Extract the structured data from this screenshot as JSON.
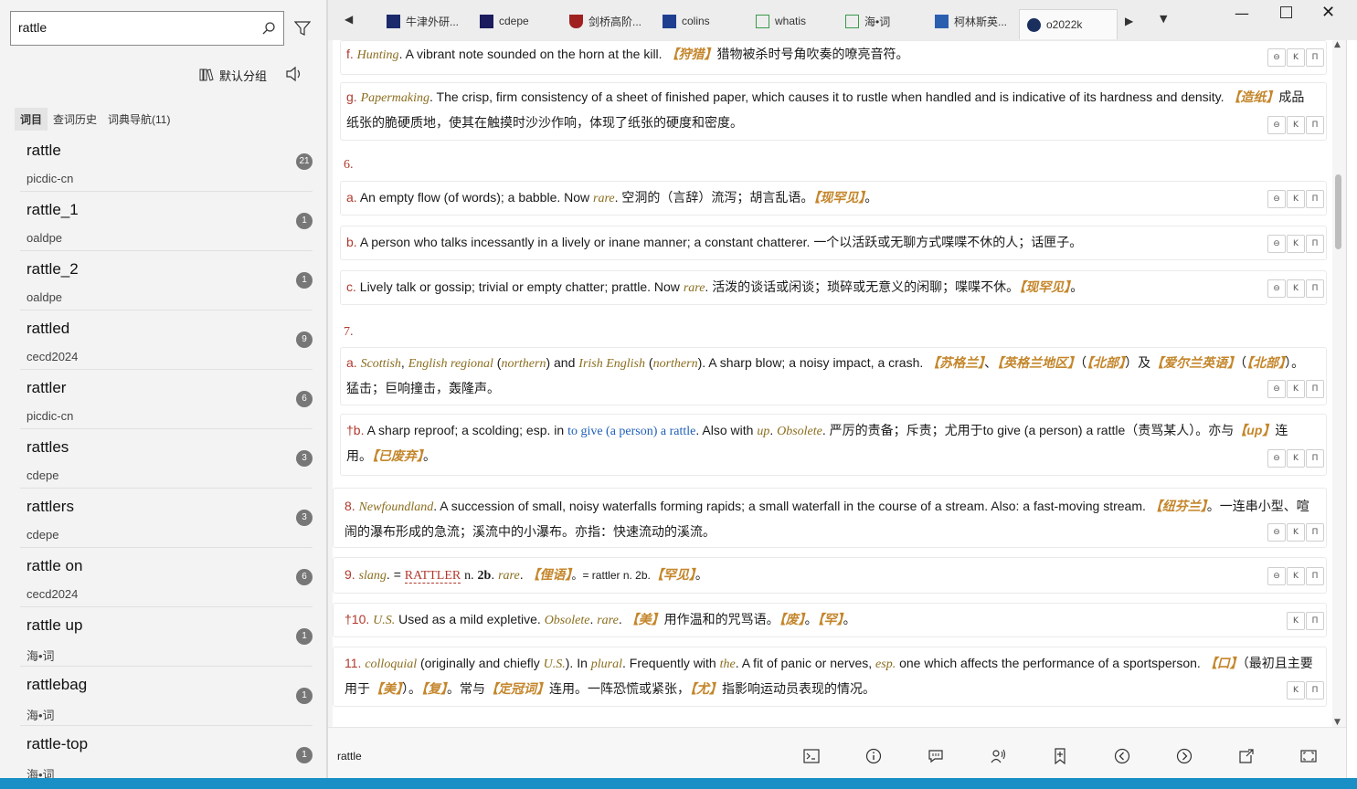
{
  "search": {
    "value": "rattle"
  },
  "group": {
    "label": "默认分组"
  },
  "left_tabs": [
    {
      "label": "词目"
    },
    {
      "label": "查词历史"
    },
    {
      "label": "词典导航(11)"
    }
  ],
  "word_list": [
    {
      "word": "rattle",
      "source": "picdic-cn",
      "count": "21"
    },
    {
      "word": "rattle_1",
      "source": "oaldpe",
      "count": "1"
    },
    {
      "word": "rattle_2",
      "source": "oaldpe",
      "count": "1"
    },
    {
      "word": "rattled",
      "source": "cecd2024",
      "count": "9"
    },
    {
      "word": "rattler",
      "source": "picdic-cn",
      "count": "6"
    },
    {
      "word": "rattles",
      "source": "cdepe",
      "count": "3"
    },
    {
      "word": "rattlers",
      "source": "cdepe",
      "count": "3"
    },
    {
      "word": "rattle on",
      "source": "cecd2024",
      "count": "6"
    },
    {
      "word": "rattle up",
      "source": "海•词",
      "count": "1"
    },
    {
      "word": "rattlebag",
      "source": "海•词",
      "count": "1"
    },
    {
      "word": "rattle-top",
      "source": "海•词",
      "count": "1"
    }
  ],
  "tabs": [
    {
      "label": "牛津外研...",
      "color": "#1a2a6b"
    },
    {
      "label": "cdepe",
      "color": "#1b1b5e"
    },
    {
      "label": "剑桥高阶...",
      "color": "#a02020"
    },
    {
      "label": "colins",
      "color": "#1e3f8f"
    },
    {
      "label": "whatis",
      "color": "#3a9a4a"
    },
    {
      "label": "海•词",
      "color": "#3a9a4a"
    },
    {
      "label": "柯林斯英...",
      "color": "#2a5fb0"
    },
    {
      "label": "o2022k",
      "color": "#1b2f5e"
    }
  ],
  "entries": {
    "f": {
      "label": "f.",
      "field": "Hunting",
      "def": "A vibrant note sounded on the horn at the kill.",
      "tag": "【狩猎】",
      "cn": "猎物被杀时号角吹奏的嘹亮音符。"
    },
    "g": {
      "label": "g.",
      "field": "Papermaking",
      "def": "The crisp, firm consistency of a sheet of finished paper, which causes it to rustle when handled and is indicative of its hardness and density.",
      "tag": "【造纸】",
      "cn": "成品纸张的脆硬质地，使其在触摸时沙沙作响，体现了纸张的硬度和密度。"
    },
    "s6": "6.",
    "s6a": {
      "label": "a.",
      "def": "An empty flow (of words); a babble. Now",
      "rare": "rare",
      "cn": "空洞的（言辞）流泻；胡言乱语。",
      "tag": "【现罕见】",
      "end": "。"
    },
    "s6b": {
      "label": "b.",
      "def": "A person who talks incessantly in a lively or inane manner; a constant chatterer.",
      "cn": "一个以活跃或无聊方式喋喋不休的人；话匣子。"
    },
    "s6c": {
      "label": "c.",
      "def": "Lively talk or gossip; trivial or empty chatter; prattle. Now",
      "rare": "rare",
      "cn": "活泼的谈话或闲谈；琐碎或无意义的闲聊；喋喋不休。",
      "tag": "【现罕见】",
      "end": "。"
    },
    "s7": "7.",
    "s7a": {
      "label": "a.",
      "l1": "Scottish",
      "c1": ",",
      "l2": "English regional",
      "p1": "(",
      "l3": "northern",
      "p2": ") and",
      "l4": "Irish English",
      "p3": "(",
      "l5": "northern",
      "p4": ").",
      "def": "A sharp blow; a noisy impact, a crash.",
      "tag1": "【苏格兰】",
      "sep": "、",
      "tag2": "【英格兰地区】",
      "p5": "（",
      "tag3": "【北部】",
      "p6": "）及",
      "tag4": "【爱尔兰英语】",
      "p7": "（",
      "tag5": "【北部】",
      "p8": "）。",
      "cn": "猛击；巨响撞击，轰隆声。"
    },
    "s7b": {
      "label": "†b.",
      "def": "A sharp reproof; a scolding; esp. in",
      "link": "to give (a person) a rattle",
      "def2": ". Also with",
      "up": "up",
      "dot": ".",
      "obs": "Obsolete",
      "dot2": ".",
      "cn": "严厉的责备；斥责；尤用于to give (a person) a rattle（责骂某人）。亦与",
      "tagup": "【up】",
      "cn2": "连用。",
      "tagobs": "【已废弃】",
      "end": "。"
    },
    "s8": {
      "label": "8.",
      "field": "Newfoundland",
      "def": ". A succession of small, noisy waterfalls forming rapids; a small waterfall in the course of a stream. Also: a fast-moving stream.",
      "tag": "【纽芬兰】",
      "cn": "。一连串小型、喧闹的瀑布形成的急流；溪流中的小瀑布。亦指：快速流动的溪流。"
    },
    "s9": {
      "label": "9.",
      "field": "slang",
      "eq": ". =",
      "ref": "RATTLER",
      "n": "n.",
      "num": "2b",
      "rare": "rare",
      "tag": "【俚语】",
      "mid": "。= rattler n. 2b.",
      "tag2": "【罕见】",
      "end": "。"
    },
    "s10": {
      "label": "†10.",
      "field": "U.S.",
      "def": "Used as a mild expletive.",
      "obs": "Obsolete",
      "dot": ".",
      "rare": "rare",
      "dot2": ".",
      "tag": "【美】",
      "cn": "用作温和的咒骂语。",
      "tag2": "【废】",
      "sep": "。",
      "tag3": "【罕】",
      "end": "。"
    },
    "s11": {
      "label": "11.",
      "field": "colloquial",
      "p1": "(originally and chiefly",
      "us": "U.S.",
      "p2": "). In",
      "pl": "plural",
      "p3": ". Frequently with",
      "the": "the",
      "p4": ". A fit of panic or nerves,",
      "esp": "esp.",
      "p5": "one which affects the performance of a sportsperson.",
      "tag": "【口】",
      "cn1": "（最初且主要用于",
      "tag2": "【美】",
      "cn2": "）。",
      "tag3": "【复】",
      "cn3": "。常与",
      "tag4": "【定冠词】",
      "cn4": "连用。一阵恐慌或紧张，",
      "tag5": "【尤】",
      "cn5": "指影响运动员表现的情况。"
    }
  },
  "sense_buttons": [
    "⊖",
    "K",
    "П"
  ],
  "status": {
    "word": "rattle"
  }
}
